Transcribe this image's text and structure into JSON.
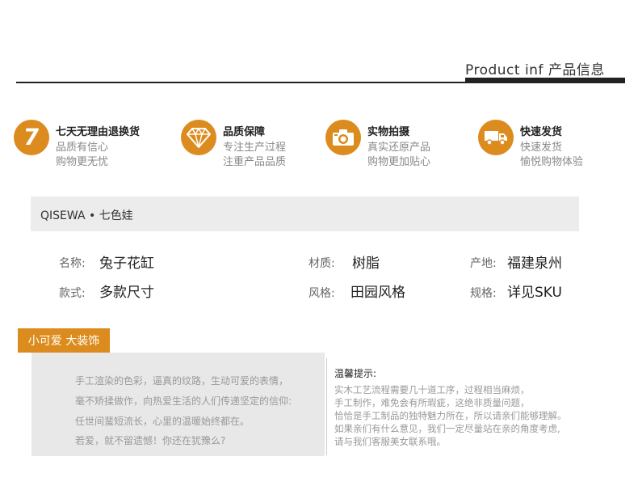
{
  "header": {
    "title": "Product inf 产品信息"
  },
  "features": [
    {
      "icon": "seven-day-badge-icon",
      "title": "七天无理由退换货",
      "line1": "品质有信心",
      "line2": "购物更无忧",
      "icon_text": "7"
    },
    {
      "icon": "diamond-icon",
      "title": "品质保障",
      "line1": "专注生产过程",
      "line2": "注重产品品质"
    },
    {
      "icon": "camera-icon",
      "title": "实物拍摄",
      "line1": "真实还原产品",
      "line2": "购物更加贴心"
    },
    {
      "icon": "delivery-truck-icon",
      "title": "快速发货",
      "line1": "快速发货",
      "line2": "愉悦购物体验"
    }
  ],
  "brand": {
    "text": "QISEWA • 七色娃"
  },
  "attributes": [
    {
      "label": "名称:",
      "value": "兔子花缸"
    },
    {
      "label": "材质:",
      "value": "树脂"
    },
    {
      "label": "产地:",
      "value": "福建泉州"
    },
    {
      "label": "款式:",
      "value": "多款尺寸"
    },
    {
      "label": "风格:",
      "value": "田园风格"
    },
    {
      "label": "规格:",
      "value": "详见SKU"
    }
  ],
  "tag": {
    "text": "小可爱 大装饰"
  },
  "description": [
    "手工渲染的色彩，逼真的纹路，生动可爱的表情，",
    "毫不矫揉做作，向热爱生活的人们传递坚定的信仰:",
    "任世间蜚短流长，心里的温暖始终都在。",
    "若爱，就不留遗憾！你还在犹豫么?"
  ],
  "tips": {
    "title": "温馨提示:",
    "lines": [
      "实木工艺流程需要几十道工序，过程相当麻烦，",
      "手工制作，难免会有所瑕疵，这绝非质量问题，",
      "恰恰是手工制品的独特魅力所在，所以请亲们能够理解。",
      "如果亲们有什么意见，我们一定尽量站在亲的角度考虑,",
      "请与我们客服美女联系哦。"
    ]
  },
  "colors": {
    "accent": "#dc8c1e",
    "brand_bar": "#ececec",
    "desc_box": "#e8e8e8"
  }
}
